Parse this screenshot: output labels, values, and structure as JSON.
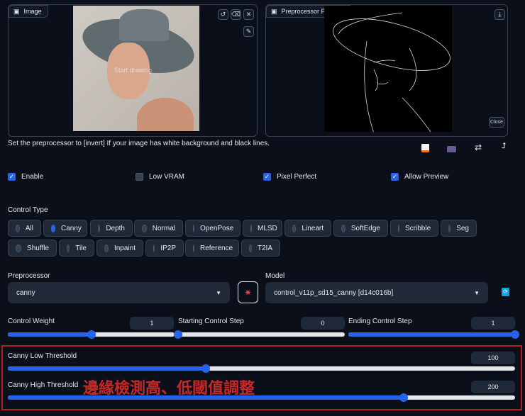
{
  "image_panel": {
    "label": "Image",
    "overlay": "Start drawing",
    "buttons": [
      "undo",
      "erase",
      "close",
      "brush"
    ]
  },
  "preview_panel": {
    "label": "Preprocessor Preview",
    "close_label": "Close"
  },
  "hint": "Set the preprocessor to [invert] If your image has white background and black lines.",
  "checkboxes": [
    {
      "label": "Enable",
      "checked": true
    },
    {
      "label": "Low VRAM",
      "checked": false
    },
    {
      "label": "Pixel Perfect",
      "checked": true
    },
    {
      "label": "Allow Preview",
      "checked": true
    }
  ],
  "control_type": {
    "label": "Control Type",
    "options": [
      "All",
      "Canny",
      "Depth",
      "Normal",
      "OpenPose",
      "MLSD",
      "Lineart",
      "SoftEdge",
      "Scribble",
      "Seg",
      "Shuffle",
      "Tile",
      "Inpaint",
      "IP2P",
      "Reference",
      "T2IA"
    ],
    "selected": "Canny"
  },
  "preprocessor": {
    "label": "Preprocessor",
    "value": "canny"
  },
  "model": {
    "label": "Model",
    "value": "control_v11p_sd15_canny [d14c016b]"
  },
  "sliders": [
    {
      "label": "Control Weight",
      "value": "1",
      "fraction": 0.5
    },
    {
      "label": "Starting Control Step",
      "value": "0",
      "fraction": 0
    },
    {
      "label": "Ending Control Step",
      "value": "1",
      "fraction": 1
    },
    {
      "label": "Canny Low Threshold",
      "value": "100",
      "fraction": 0.39
    },
    {
      "label": "Canny High Threshold",
      "value": "200",
      "fraction": 0.78
    }
  ],
  "annotation": "邊緣檢測高、低閾值調整",
  "colors": {
    "accent": "#2563eb",
    "annotation": "#c62828"
  }
}
